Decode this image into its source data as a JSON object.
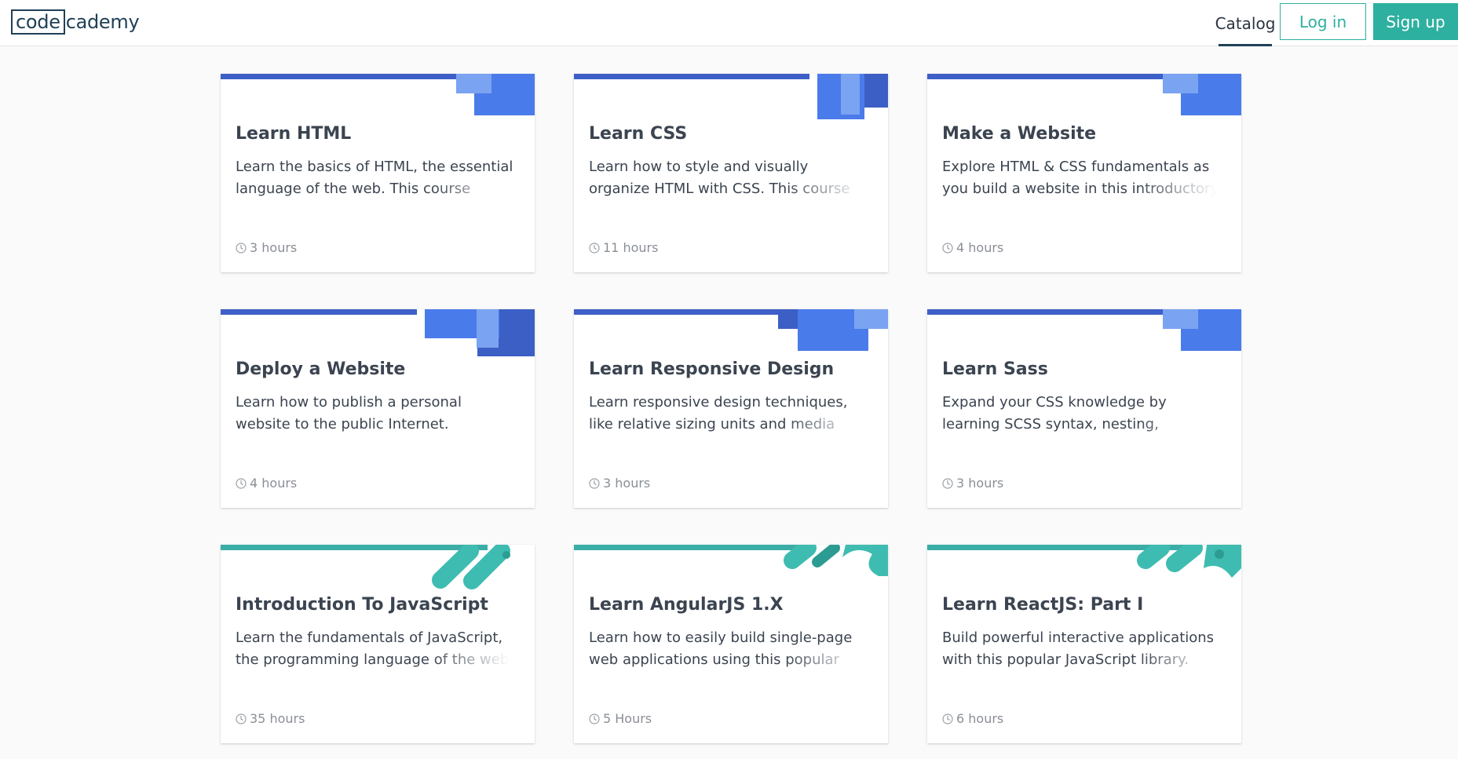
{
  "header": {
    "logo_box": "code",
    "logo_rest": "cademy",
    "nav_catalog": "Catalog",
    "login": "Log in",
    "signup": "Sign up"
  },
  "colors": {
    "blue_stripe": "#3d5fc7",
    "blue_block": "#4a7bea",
    "blue_light": "#7aa3f2",
    "blue_dark": "#3b5fc4",
    "teal": "#3fbcb1",
    "teal_dark": "#2c9c93",
    "teal_stripe": "#3aaea6",
    "brand": "#2eb0a0"
  },
  "courses": [
    {
      "title": "Learn HTML",
      "desc": "Learn the basics of HTML, the essential language of the web. This course covers",
      "duration": "3 hours",
      "icon": "clock-icon"
    },
    {
      "title": "Learn CSS",
      "desc": "Learn how to style and visually organize HTML with CSS. This course covers vers",
      "duration": "11 hours",
      "icon": "clock-icon"
    },
    {
      "title": "Make a Website",
      "desc": "Explore HTML & CSS fundamentals as you build a website in this introductory cour",
      "duration": "4 hours",
      "icon": "clock-icon"
    },
    {
      "title": "Deploy a Website",
      "desc": "Learn how to publish a personal website to the public Internet.",
      "duration": "4 hours",
      "icon": "clock-icon"
    },
    {
      "title": "Learn Responsive Design",
      "desc": "Learn responsive design techniques, like relative sizing units and media queries, t",
      "duration": "3 hours",
      "icon": "clock-icon"
    },
    {
      "title": "Learn Sass",
      "desc": "Expand your CSS knowledge by learning SCSS syntax, nesting, functions, and mo",
      "duration": "3 hours",
      "icon": "clock-icon"
    },
    {
      "title": "Introduction To JavaScript",
      "desc": "Learn the fundamentals of JavaScript, the programming language of the web.",
      "duration": "35 hours",
      "icon": "clock-icon"
    },
    {
      "title": "Learn AngularJS 1.X",
      "desc": "Learn how to easily build single-page web applications using this popular JavaScrip",
      "duration": "5 Hours",
      "icon": "clock-icon"
    },
    {
      "title": "Learn ReactJS: Part I",
      "desc": "Build powerful interactive applications with this popular JavaScript library.",
      "duration": "6 hours",
      "icon": "clock-icon"
    }
  ]
}
